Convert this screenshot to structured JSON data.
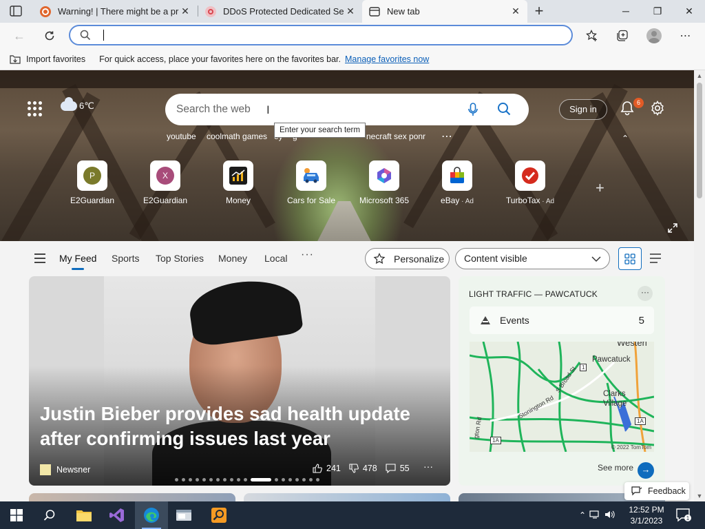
{
  "tabs": [
    {
      "title": "Warning! | There might be a problem with the requested link",
      "close": "✕"
    },
    {
      "title": "DDoS Protected Dedicated Servers",
      "close": "✕"
    },
    {
      "title": "New tab",
      "close": "✕"
    }
  ],
  "new_tab_symbol": "+",
  "address_bar": {
    "value": "",
    "placeholder": ""
  },
  "favorites_bar": {
    "import_label": "Import favorites",
    "hint": "For quick access, place your favorites here on the favorites bar.",
    "manage_link": "Manage favorites now"
  },
  "hero": {
    "weather": "6℃",
    "search_placeholder": "Search the web",
    "tooltip": "Enter your search term",
    "suggestions": [
      "youtube",
      "coolmath games",
      "ey",
      "g",
      "necraft sex ponr"
    ],
    "sign_in": "Sign in",
    "notification_count": "6",
    "quick_links": [
      {
        "label": "E2Guardian",
        "letter": "P",
        "color": "#7a7a2b",
        "ad": ""
      },
      {
        "label": "E2Guardian",
        "letter": "X",
        "color": "#a84c7a",
        "ad": ""
      },
      {
        "label": "Money",
        "letter": "",
        "color": "#1b1b1b",
        "ad": ""
      },
      {
        "label": "Cars for Sale",
        "letter": "",
        "color": "#2f7ad6",
        "ad": ""
      },
      {
        "label": "Microsoft 365",
        "letter": "",
        "color": "#6a5ad8",
        "ad": ""
      },
      {
        "label": "eBay",
        "letter": "",
        "color": "#e43137",
        "ad": "Ad"
      },
      {
        "label": "TurboTax",
        "letter": "",
        "color": "#d52b1e",
        "ad": "Ad"
      }
    ]
  },
  "feed_nav": {
    "tabs": [
      "My Feed",
      "Sports",
      "Top Stories",
      "Money",
      "Local"
    ],
    "more": "···",
    "personalize": "Personalize",
    "visibility": "Content visible"
  },
  "main_card": {
    "headline": "Justin Bieber provides sad health update after confirming issues last year",
    "source": "Newsner",
    "likes": "241",
    "dislikes": "478",
    "comments": "55",
    "more": "···",
    "slide_count": 19,
    "active_slide": 11
  },
  "traffic_card": {
    "title": "LIGHT TRAFFIC — PAWCATUCK",
    "more": "···",
    "events_label": "Events",
    "events_count": "5",
    "map_places": [
      "Westerl",
      "Pawcatuck",
      "Clarks",
      "Village",
      "Stonington Rd",
      "S Broad St",
      "gton Rd",
      "1A",
      "1A",
      "1"
    ],
    "map_copyright": "© 2022 TomTom",
    "see_more": "See more"
  },
  "feedback": "Feedback",
  "taskbar": {
    "time": "12:52 PM",
    "date": "3/1/2023",
    "notifications": "1"
  },
  "colors": {
    "accent": "#0f6cbd",
    "taskbar": "#1e2a3a",
    "traffic_green": "#1fb45a",
    "traffic_orange": "#f0a23a"
  }
}
